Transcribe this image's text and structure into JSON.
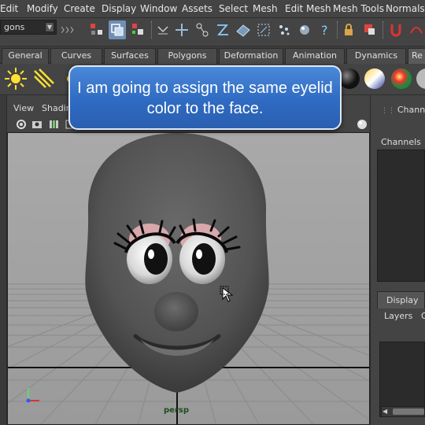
{
  "menu": [
    "Edit",
    "Modify",
    "Create",
    "Display",
    "Window",
    "Assets",
    "Select",
    "Mesh",
    "Edit Mesh",
    "Mesh Tools",
    "Normals"
  ],
  "toolbar": {
    "mode_value": "gons"
  },
  "shelf_tabs": [
    "General",
    "Curves",
    "Surfaces",
    "Polygons",
    "Deformation",
    "Animation",
    "Dynamics",
    "Re"
  ],
  "callout": {
    "text": "I am going to assign the same eyelid color to the face."
  },
  "panel_menu": [
    "View",
    "Shading"
  ],
  "viewport": {
    "camera": "persp"
  },
  "right_panel": {
    "channel_tab": "Channel",
    "channels_label": "Channels",
    "display_tab": "Display",
    "layers_label": "Layers",
    "layers_extra": "O"
  },
  "colors": {
    "callout_bg": "#2f6bc2",
    "viewport_bg": "#a8a8a8",
    "head": "#5a5a5a",
    "lash": "#0a0a0a",
    "eyelid_pink": "#d9a8ac"
  }
}
